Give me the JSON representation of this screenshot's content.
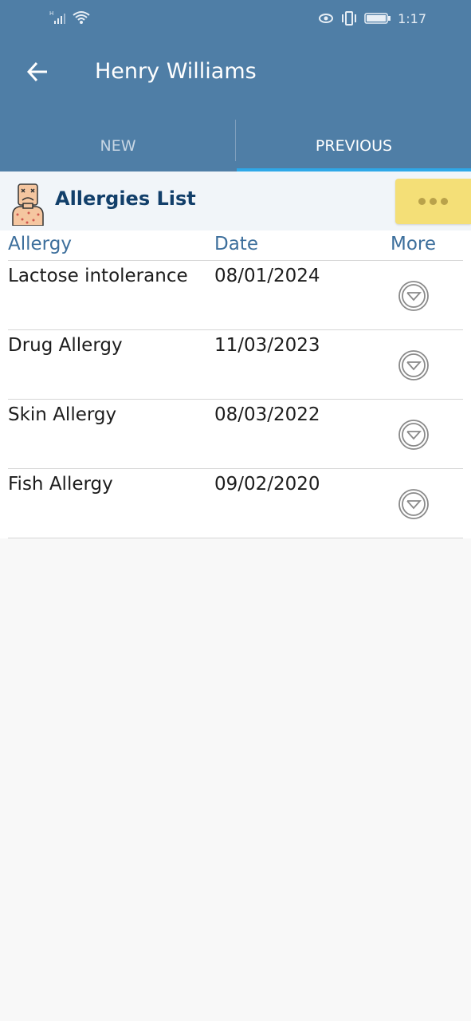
{
  "status_bar": {
    "time": "1:17",
    "icons": [
      "signal-icon",
      "wifi-icon",
      "eye-icon",
      "vibrate-icon",
      "battery-icon"
    ]
  },
  "header": {
    "title": "Henry Williams",
    "back_icon": "arrow-left-icon",
    "background_color": "#4f7ea6"
  },
  "tabs": [
    {
      "label": "NEW",
      "active": false
    },
    {
      "label": "PREVIOUS",
      "active": true
    }
  ],
  "list": {
    "title": "Allergies List",
    "menu_icon": "more-dots-icon",
    "columns": [
      "Allergy",
      "Date",
      "More"
    ],
    "rows": [
      {
        "allergy": "Lactose intolerance",
        "date": "08/01/2024"
      },
      {
        "allergy": "Drug Allergy",
        "date": "11/03/2023"
      },
      {
        "allergy": "Skin Allergy",
        "date": "08/03/2022"
      },
      {
        "allergy": "Fish Allergy",
        "date": "09/02/2020"
      }
    ]
  },
  "colors": {
    "accent": "#2ea8e8",
    "title_text": "#123f6a",
    "column_header": "#3d6f9c",
    "menu_highlight": "#f4df77"
  }
}
